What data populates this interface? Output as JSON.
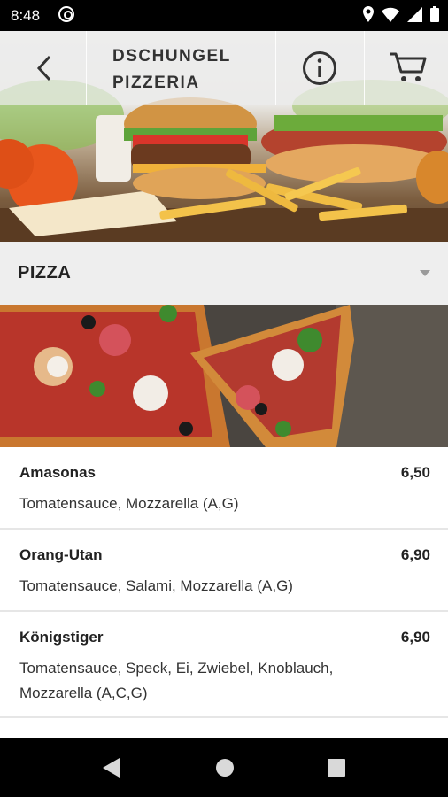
{
  "status_bar": {
    "time": "8:48"
  },
  "header": {
    "title": "DSCHUNGEL\nPIZZERIA"
  },
  "category": {
    "label": "PIZZA"
  },
  "menu_items": [
    {
      "name": "Amasonas",
      "price": "6,50",
      "description": "Tomatensauce, Mozzarella (A,G)"
    },
    {
      "name": "Orang-Utan",
      "price": "6,90",
      "description": "Tomatensauce, Salami, Mozzarella (A,G)"
    },
    {
      "name": "Königstiger",
      "price": "6,90",
      "description": "Tomatensauce, Speck, Ei, Zwiebel, Knoblauch, Mozzarella (A,C,G)"
    }
  ],
  "colors": {
    "accent_text": "#222222",
    "category_bg": "#eeeeee",
    "appbar_bg": "#ececec"
  }
}
